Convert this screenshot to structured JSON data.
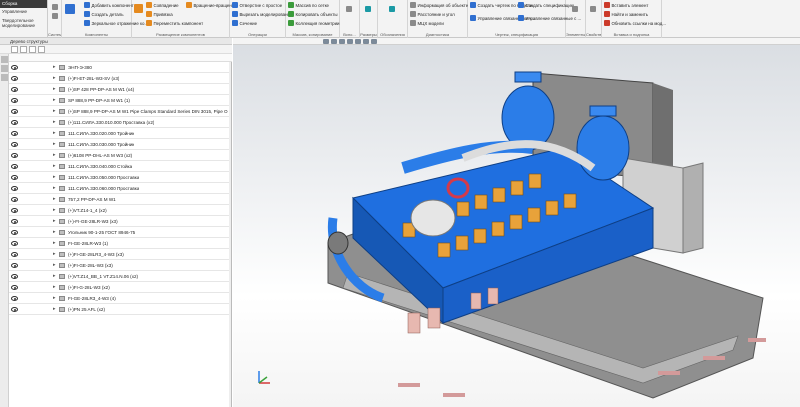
{
  "left_nav": {
    "items": [
      "Сборка",
      "Управление",
      "Твердотельное моделирование"
    ]
  },
  "ribbon": {
    "groups": [
      {
        "title": "Системная",
        "items": []
      },
      {
        "title": "Компоненты",
        "items": [
          "Добавить компонент из...",
          "Создать деталь",
          "Зеркальное отражение ко..."
        ]
      },
      {
        "title": "Размещение компонентов",
        "items": [
          "Совпадение",
          "Привязка",
          "Переместить компонент"
        ]
      },
      {
        "title": "",
        "items": [
          "Вращение-вращение"
        ]
      },
      {
        "title": "Операции",
        "items": [
          "Отверстие с простое",
          "Вырезать моделирование",
          "Сечение"
        ]
      },
      {
        "title": "Массив, копирование",
        "items": [
          "Массив по сетке",
          "Копировать объекты",
          "Коллекция геометрии"
        ]
      },
      {
        "title": "Вспо...",
        "items": []
      },
      {
        "title": "Размеры",
        "items": []
      },
      {
        "title": "Обозначения",
        "items": []
      },
      {
        "title": "Диагностика",
        "items": [
          "Информация об объекте",
          "Расстояние и угол",
          "МЦХ модели"
        ]
      },
      {
        "title": "Чертеж, спецификация",
        "items": [
          "Создать чертеж по модели",
          "Управление связанными ч...",
          "Создать спецификацию...",
          "Управление связанные с ..."
        ]
      },
      {
        "title": "Элементы оформления",
        "items": []
      },
      {
        "title": "Свойства",
        "items": []
      },
      {
        "title": "Вставка и подгонка",
        "items": [
          "Вставить элемент",
          "Найти и заменить",
          "Обновить ссылки на мод..."
        ]
      }
    ]
  },
  "panel": {
    "title": "Дерево структуры",
    "rows": [
      "ЭНП-Э-380",
      "(+)FI-ET-28L-W3-SV (x3)",
      "(+)SP 428 PP-DP-AS M W1 (x4)",
      "SP 888,9 PP-DP-AS M W1 (1)",
      "(+)SP 888,9 PP-DP-AS M W1 Pipe Clamps Standard Series DIN 3015, Pipe O.D.",
      "(+)111.СИЛА.330.010.000 Проставка (x2)",
      "111.СИЛА.330.020.000 Тройник",
      "111.СИЛА.330.030.000 Тройник",
      "(+)6108 PP-DHL-AS M W3 (x2)",
      "111.СИЛА.330.040.000 Стойка",
      "111.СИЛА.330.050.000 Проставка",
      "111.СИЛА.330.060.000 Проставка",
      "757,2 PP-DP-AS M W1",
      "(+)VT.Z14-1_4 (x2)",
      "(+)-FI-GE-28LR-W3 (x3)",
      "Угольник 90-1-25 ГОСТ 8946-75",
      "FI-GE-28LR-W3 (1)",
      "(+)FI-GE-28LR3_4-W3 (x3)",
      "(+)FI-GE-28L-W3 (x3)",
      "(+)VT.Z14_BB_1 VT.Z14.N.06 (x2)",
      "(+)FI-G-28L-W3 (x2)",
      "FI-GE-28LR3_4-W3 (4)",
      "(+)PN 25 AFL (x2)"
    ]
  },
  "viewport": {
    "axes": [
      "X",
      "Y",
      "Z"
    ]
  },
  "colors": {
    "engine_blue": "#1f6fe0",
    "frame_gray": "#9a9a9a",
    "accent_orange": "#e8a23a"
  }
}
